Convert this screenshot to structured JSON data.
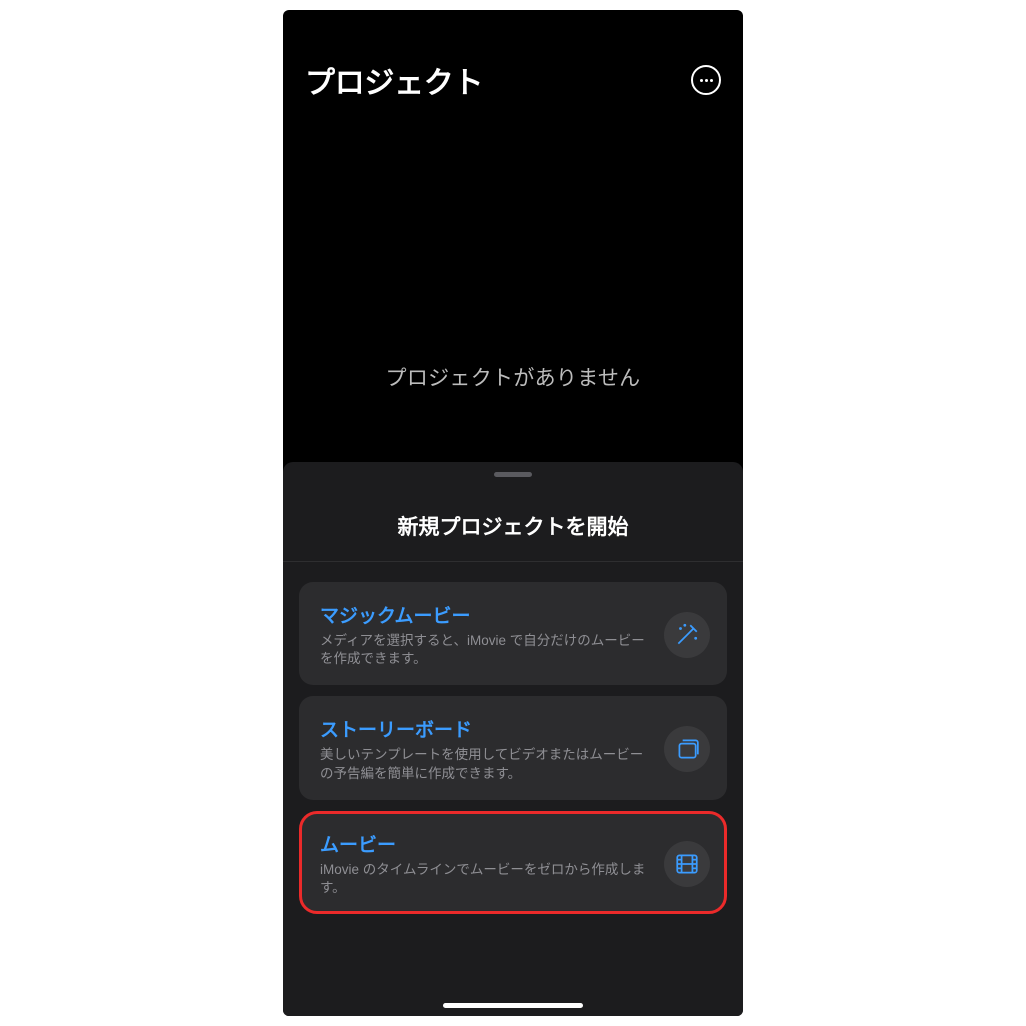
{
  "header": {
    "title": "プロジェクト"
  },
  "empty": {
    "message": "プロジェクトがありません"
  },
  "sheet": {
    "title": "新規プロジェクトを開始",
    "options": [
      {
        "title": "マジックムービー",
        "desc": "メディアを選択すると、iMovie で自分だけのムービーを作成できます。",
        "icon": "magic-wand"
      },
      {
        "title": "ストーリーボード",
        "desc": "美しいテンプレートを使用してビデオまたはムービーの予告編を簡単に作成できます。",
        "icon": "storyboard"
      },
      {
        "title": "ムービー",
        "desc": "iMovie のタイムラインでムービーをゼロから作成します。",
        "icon": "film"
      }
    ]
  }
}
